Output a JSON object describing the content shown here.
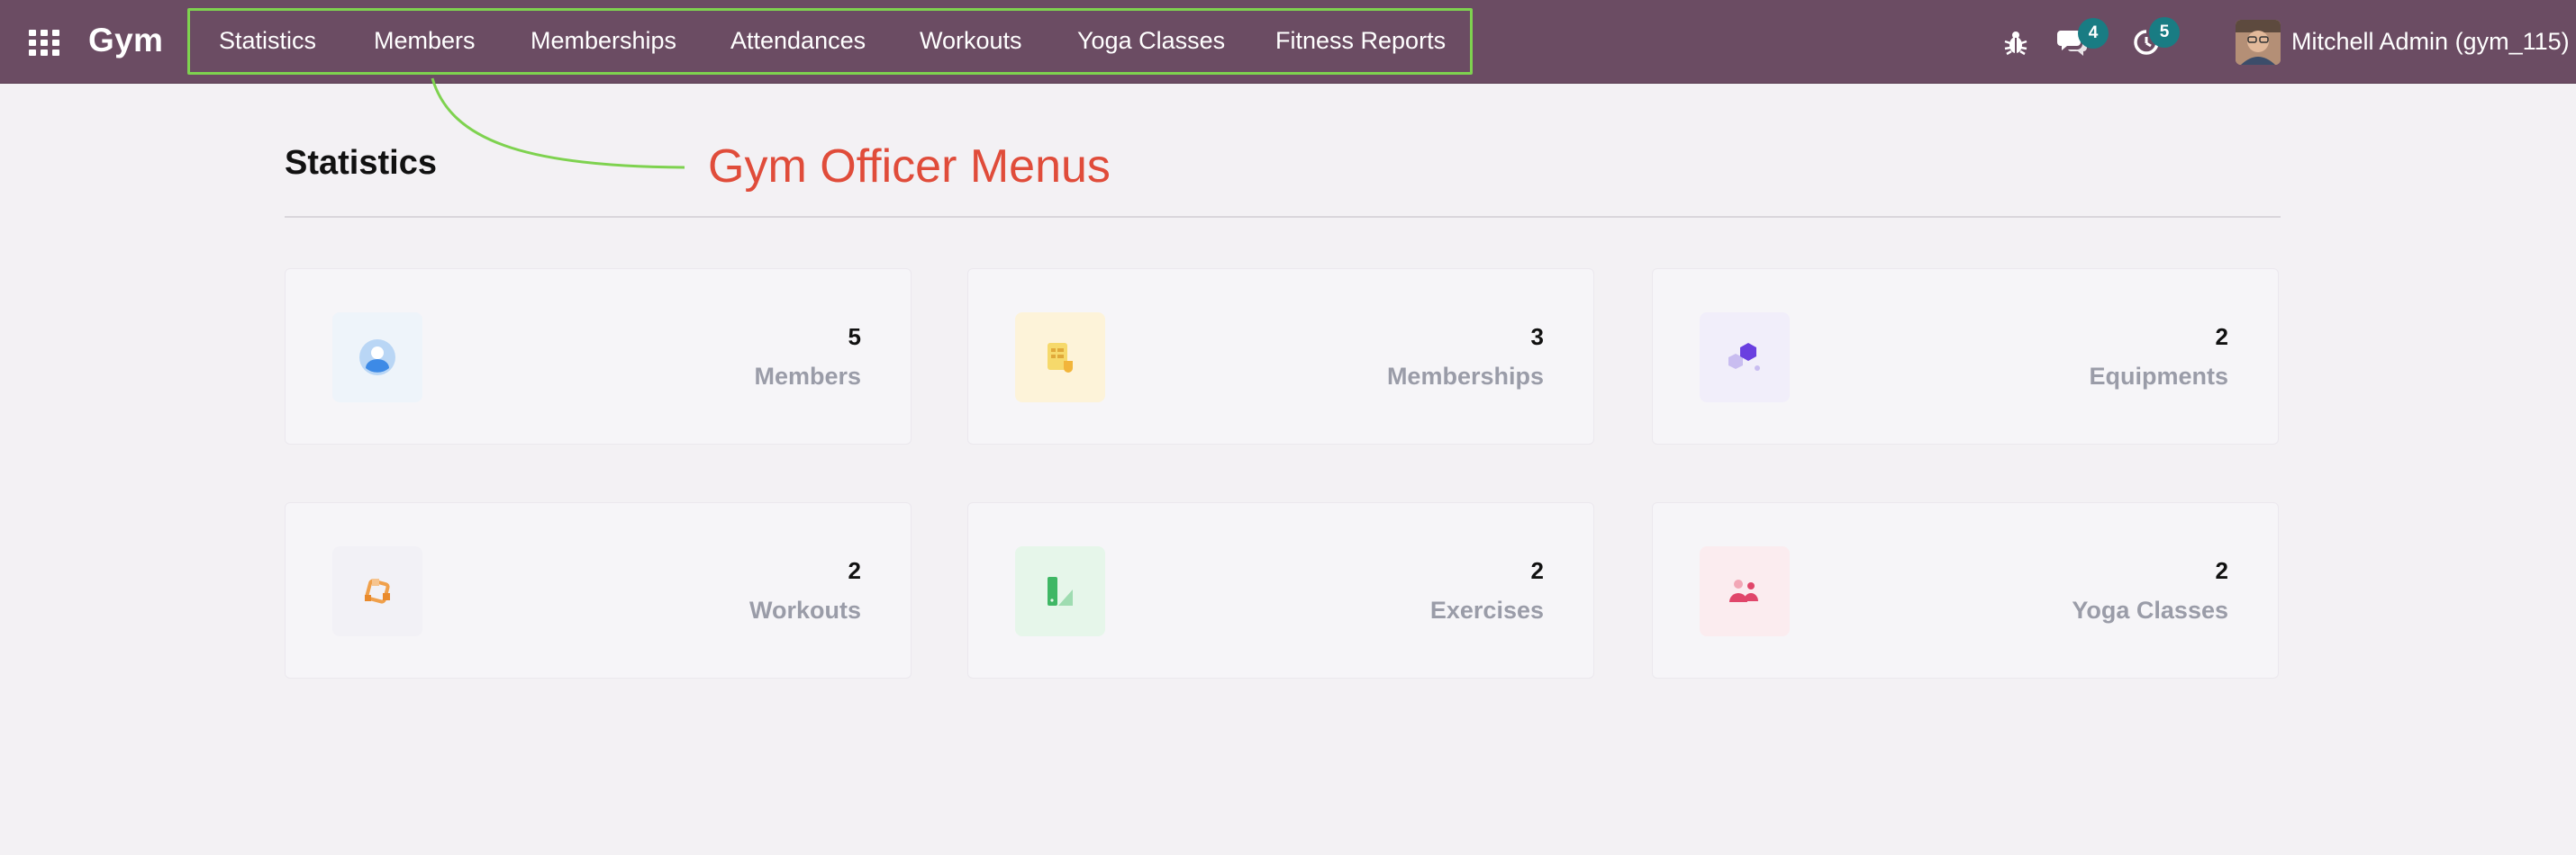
{
  "app": {
    "brand": "Gym"
  },
  "navbar": {
    "menus": [
      {
        "label": "Statistics"
      },
      {
        "label": "Members"
      },
      {
        "label": "Memberships"
      },
      {
        "label": "Attendances"
      },
      {
        "label": "Workouts"
      },
      {
        "label": "Yoga Classes"
      },
      {
        "label": "Fitness Reports"
      }
    ],
    "icons": [
      "apps-grid-icon",
      "bug-icon",
      "chat-icon",
      "activity-clock-icon"
    ],
    "messages_badge": "4",
    "activities_badge": "5",
    "user": "Mitchell Admin (gym_115)"
  },
  "annotation": {
    "text": "Gym Officer Menus",
    "color": "#e04c3a",
    "box_color": "#7ed24f"
  },
  "page": {
    "title": "Statistics"
  },
  "cards": [
    {
      "count": "5",
      "label": "Members",
      "icon": "member-icon"
    },
    {
      "count": "3",
      "label": "Memberships",
      "icon": "membership-icon"
    },
    {
      "count": "2",
      "label": "Equipments",
      "icon": "equipment-icon"
    },
    {
      "count": "2",
      "label": "Workouts",
      "icon": "workout-icon"
    },
    {
      "count": "2",
      "label": "Exercises",
      "icon": "exercise-icon"
    },
    {
      "count": "2",
      "label": "Yoga Classes",
      "icon": "yoga-icon"
    }
  ],
  "colors": {
    "navbar": "#6b4c63",
    "badge": "#197c83",
    "background": "#f3f1f4"
  }
}
